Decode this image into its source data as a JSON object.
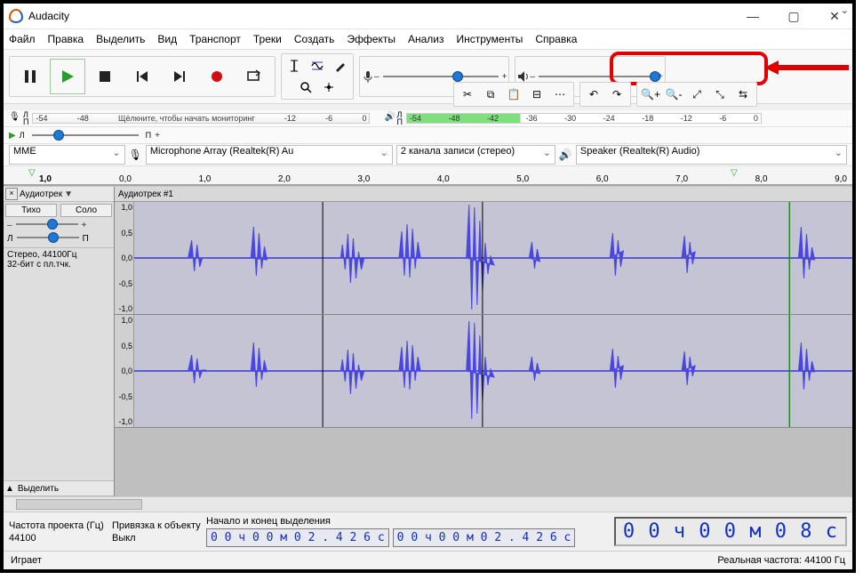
{
  "window": {
    "title": "Audacity"
  },
  "menu": [
    "Файл",
    "Правка",
    "Выделить",
    "Вид",
    "Транспорт",
    "Треки",
    "Создать",
    "Эффекты",
    "Анализ",
    "Инструменты",
    "Справка"
  ],
  "transport": {
    "pause": "pause",
    "play": "play",
    "stop": "stop",
    "skip_start": "skip-start",
    "skip_end": "skip-end",
    "record": "record",
    "loop": "loop"
  },
  "sliders": {
    "rec_level": 60,
    "play_level": 100
  },
  "rec_meter": {
    "label_left": "Л",
    "label_right": "П",
    "ticks": [
      "-54",
      "-48"
    ],
    "hint": "Щёлкните, чтобы начать мониторинг",
    "end_ticks": [
      "-12",
      "-6",
      "0"
    ]
  },
  "play_meter": {
    "label_left": "Л",
    "label_right": "П",
    "ticks": [
      "-54",
      "-48",
      "-42",
      "-36",
      "-30",
      "-24",
      "-18",
      "-12",
      "-6",
      "0"
    ]
  },
  "playback_slider": {
    "pos": 20,
    "label_left": "Л",
    "label_right": "П"
  },
  "devices": {
    "host": "MME",
    "input": "Microphone Array (Realtek(R) Au",
    "channels": "2 канала записи (стерео)",
    "output": "Speaker (Realtek(R) Audio)"
  },
  "ruler": {
    "first_label": "1,0",
    "labels": [
      "0,0",
      "1,0",
      "2,0",
      "3,0",
      "4,0",
      "5,0",
      "6,0",
      "7,0",
      "8,0",
      "9,0"
    ]
  },
  "track": {
    "menu_label": "Аудиотрек",
    "clip_name": "Аудиотрек #1",
    "mute": "Тихо",
    "solo": "Соло",
    "format_line1": "Стерео, 44100Гц",
    "format_line2": "32-бит с пл.тчк.",
    "select_btn": "Выделить",
    "ylabels": [
      "1,0",
      "0,5",
      "0,0",
      "-0,5",
      "-1,0"
    ]
  },
  "selection": {
    "rate_label": "Частота проекта (Гц)",
    "rate_value": "44100",
    "snap_label": "Привязка к объекту",
    "snap_value": "Выкл",
    "mode": "Начало и конец выделения",
    "start": "0 0 ч 0 0 м 0 2 . 4 2 6 с",
    "end": "0 0 ч 0 0 м 0 2 . 4 2 6 с",
    "big_time": "0 0 ч 0 0 м 0 8 с"
  },
  "status": {
    "state": "Играет",
    "rate": "Реальная частота: 44100 Гц"
  },
  "colors": {
    "wave": "#4a47e0",
    "accent": "#1e78d6",
    "highlight": "#e00000"
  }
}
